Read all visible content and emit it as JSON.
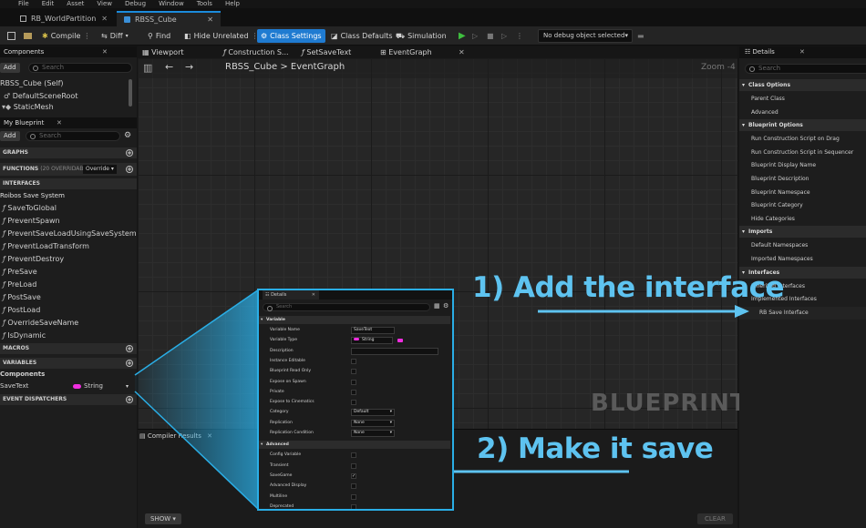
{
  "menu": [
    "File",
    "Edit",
    "Asset",
    "View",
    "Debug",
    "Window",
    "Tools",
    "Help"
  ],
  "doc_tabs": [
    {
      "label": "RB_WorldPartition"
    },
    {
      "label": "RBSS_Cube"
    }
  ],
  "toolbar": {
    "compile": "Compile",
    "diff": "Diff",
    "find": "Find",
    "hide_unrelated": "Hide Unrelated",
    "class_settings": "Class Settings",
    "class_defaults": "Class Defaults",
    "simulation": "Simulation",
    "debug_object": "No debug object selected"
  },
  "components": {
    "title": "Components",
    "add": "Add",
    "search_placeholder": "Search",
    "items": [
      "RBSS_Cube (Self)",
      "DefaultSceneRoot",
      "StaticMesh"
    ]
  },
  "my_blueprint": {
    "title": "My Blueprint",
    "add": "Add",
    "search_placeholder": "Search",
    "graphs": "GRAPHS",
    "functions": "FUNCTIONS",
    "functions_note": "(20 OVERRIDABLE)",
    "override": "Override",
    "interfaces": "INTERFACES",
    "interface_group": "Roibos Save System",
    "interface_functions": [
      "SaveToGlobal",
      "PreventSpawn",
      "PreventSaveLoadUsingSaveSystem",
      "PreventLoadTransform",
      "PreventDestroy",
      "PreSave",
      "PreLoad",
      "PostSave",
      "PostLoad",
      "OverrideSaveName",
      "IsDynamic"
    ],
    "macros": "MACROS",
    "variables": "VARIABLES",
    "components_group": "Components",
    "variable": {
      "name": "SaveText",
      "type": "String"
    },
    "event_dispatchers": "EVENT DISPATCHERS"
  },
  "graph_tabs": [
    "Viewport",
    "Construction S...",
    "SetSaveText",
    "EventGraph"
  ],
  "graph": {
    "breadcrumb_root": "RBSS_Cube",
    "breadcrumb_sep": ">",
    "breadcrumb_leaf": "EventGraph",
    "zoom": "Zoom -4",
    "watermark": "BLUEPRINT"
  },
  "compiler": {
    "tab": "Compiler Results",
    "show": "SHOW",
    "clear": "CLEAR"
  },
  "details": {
    "title": "Details",
    "search_placeholder": "Search",
    "sections": [
      {
        "title": "Class Options",
        "rows": [
          "Parent Class",
          "Advanced"
        ]
      },
      {
        "title": "Blueprint Options",
        "rows": [
          "Run Construction Script on Drag",
          "Run Construction Script in Sequencer",
          "Blueprint Display Name",
          "Blueprint Description",
          "Blueprint Namespace",
          "Blueprint Category",
          "Hide Categories"
        ]
      },
      {
        "title": "Imports",
        "rows": [
          "Default Namespaces",
          "Imported Namespaces"
        ]
      },
      {
        "title": "Interfaces",
        "rows": [
          "Inherited Interfaces",
          "Implemented Interfaces"
        ]
      }
    ],
    "implemented_interface": "RB Save Interface"
  },
  "zoom_details": {
    "title": "Details",
    "search_placeholder": "Search",
    "variable_section": "Variable",
    "rows": [
      {
        "label": "Variable Name",
        "value": "SaveText"
      },
      {
        "label": "Variable Type",
        "value": "String"
      },
      {
        "label": "Description",
        "value": ""
      },
      {
        "label": "Instance Editable",
        "check": false
      },
      {
        "label": "Blueprint Read Only",
        "check": false
      },
      {
        "label": "Expose on Spawn",
        "check": false
      },
      {
        "label": "Private",
        "check": false
      },
      {
        "label": "Expose to Cinematics",
        "check": false
      },
      {
        "label": "Category",
        "value": "Default"
      },
      {
        "label": "Replication",
        "value": "None"
      },
      {
        "label": "Replication Condition",
        "value": "None"
      }
    ],
    "advanced_section": "Advanced",
    "advanced_rows": [
      {
        "label": "Config Variable",
        "check": false
      },
      {
        "label": "Transient",
        "check": false
      },
      {
        "label": "SaveGame",
        "check": true
      },
      {
        "label": "Advanced Display",
        "check": false
      },
      {
        "label": "Multiline",
        "check": false
      },
      {
        "label": "Deprecated",
        "check": false
      }
    ]
  },
  "annotations": {
    "first": "1) Add the interface",
    "second": "2) Make it save"
  },
  "colors": {
    "accent": "#1f7bd1",
    "annotation": "#5ec3f0",
    "string_pin": "#f02ee0",
    "callout": "#2aaee6"
  }
}
